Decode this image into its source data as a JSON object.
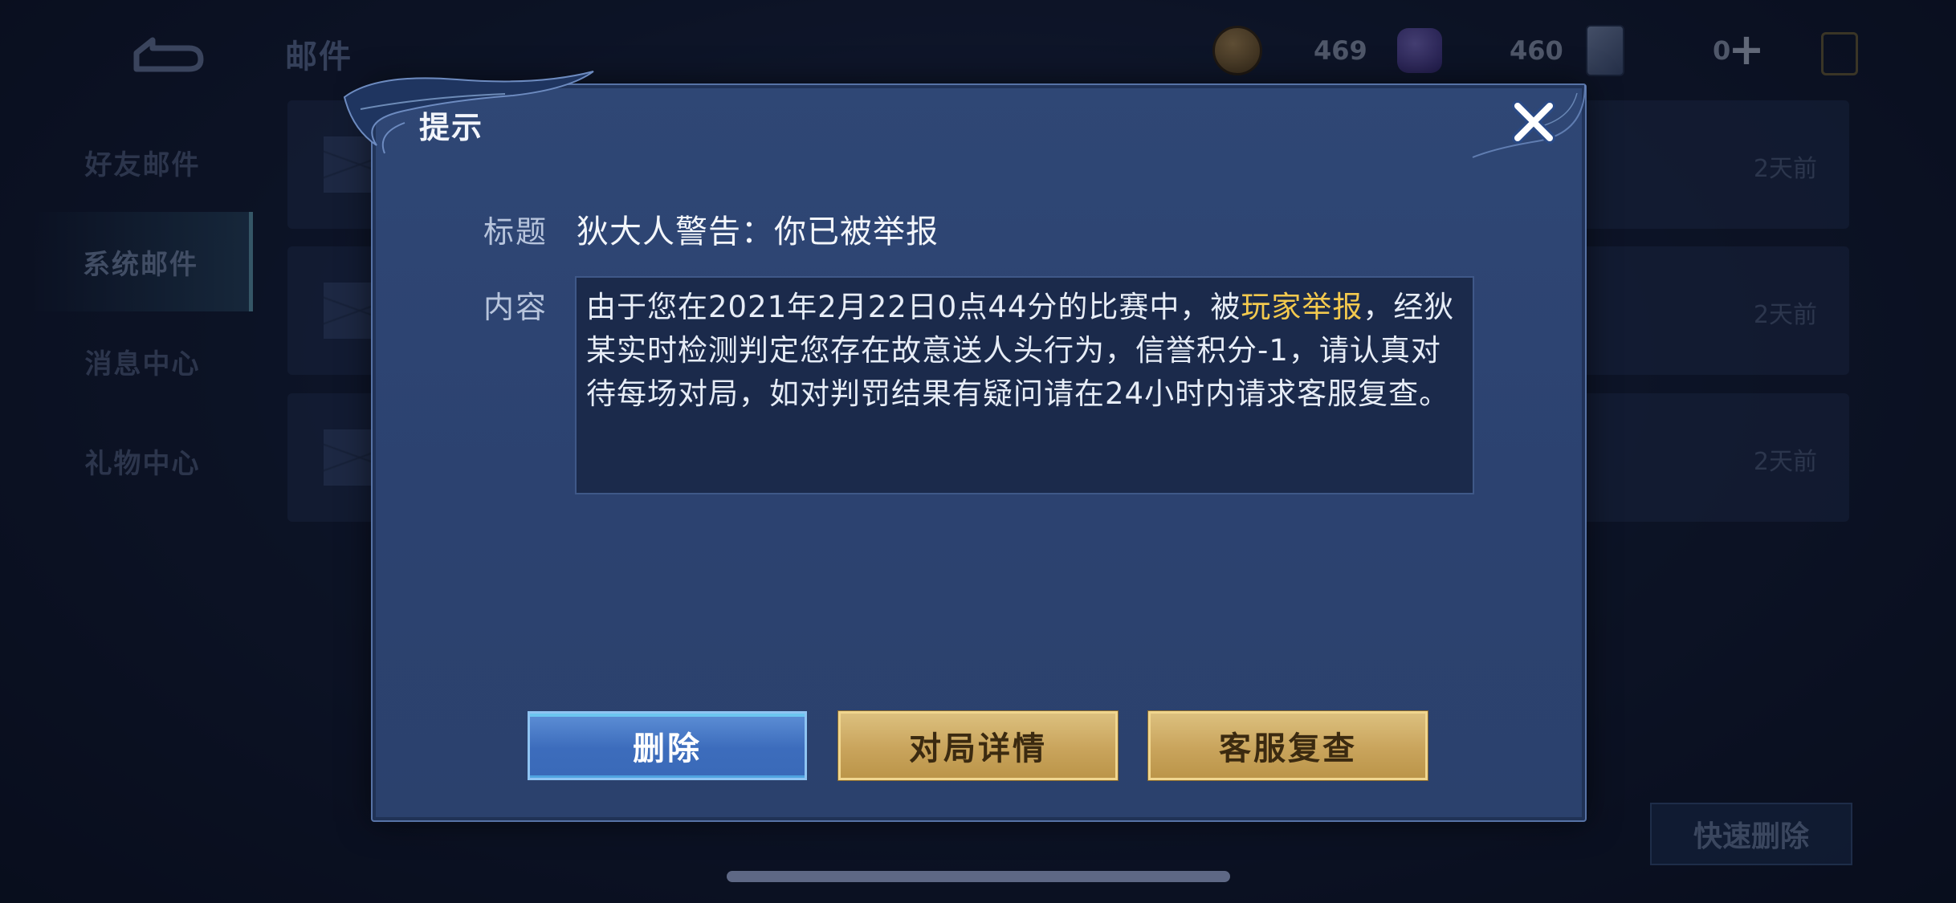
{
  "header": {
    "title": "邮件",
    "currencies": [
      {
        "icon": "gold-coin-icon",
        "value": "469"
      },
      {
        "icon": "gem-icon",
        "value": "460"
      },
      {
        "icon": "card-icon",
        "value": "0"
      }
    ]
  },
  "sidebar": {
    "items": [
      {
        "label": "好友邮件",
        "active": false
      },
      {
        "label": "系统邮件",
        "active": true
      },
      {
        "label": "消息中心",
        "active": false
      },
      {
        "label": "礼物中心",
        "active": false
      }
    ]
  },
  "mail_list": [
    {
      "time": "2天前"
    },
    {
      "time": "2天前"
    },
    {
      "time": "2天前"
    }
  ],
  "quick_delete_label": "快速删除",
  "dialog": {
    "title": "提示",
    "subject_label": "标题",
    "subject": "狄大人警告：你已被举报",
    "content_label": "内容",
    "content_before": "由于您在2021年2月22日0点44分的比赛中，被",
    "content_highlight": "玩家举报",
    "content_after": "，经狄某实时检测判定您存在故意送人头行为，信誉积分-1，请认真对待每场对局，如对判罚结果有疑问请在24小时内请求客服复查。",
    "buttons": {
      "delete": "删除",
      "match_details": "对局详情",
      "service_review": "客服复查"
    }
  },
  "colors": {
    "highlight": "#f3c94e",
    "dialog_bg": "#2f4775",
    "gold_button": "#c9a45c",
    "blue_button": "#3c6cbc"
  }
}
